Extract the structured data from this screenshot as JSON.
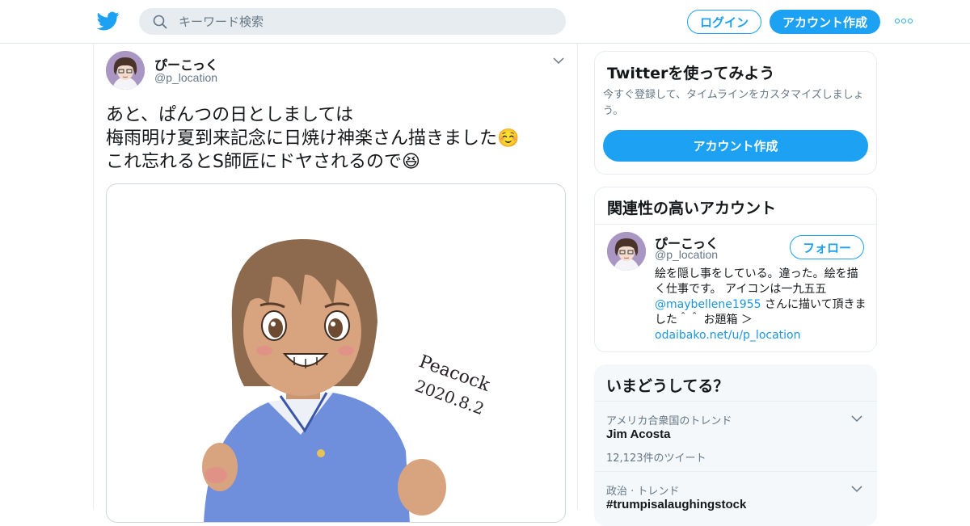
{
  "header": {
    "search_placeholder": "キーワード検索",
    "login_label": "ログイン",
    "signup_label": "アカウント作成",
    "brand_color": "#1da1f2"
  },
  "tweet": {
    "display_name": "ぴーこっく",
    "handle": "@p_location",
    "lines": [
      "あと、ぱんつの日としましては",
      "梅雨明け夏到来記念に日焼け神楽さん描きました☺️",
      "これ忘れるとS師匠にドヤされるので😆"
    ],
    "media": {
      "signature_line1": "Peacock",
      "signature_line2": "2020.8.2"
    }
  },
  "sidebar": {
    "signup_card": {
      "title": "Twitterを使ってみよう",
      "description": "今すぐ登録して、タイムラインをカスタマイズしましょう。",
      "button_label": "アカウント作成"
    },
    "related": {
      "title": "関連性の高いアカウント",
      "account": {
        "display_name": "ぴーこっく",
        "handle": "@p_location",
        "follow_label": "フォロー",
        "bio_part1": "絵を隠し事をしている。違った。絵を描く仕事です。 アイコンは一九五五 ",
        "bio_mention": "@maybellene1955",
        "bio_part2": " さんに描いて頂きました＾＾ お題箱 ＞",
        "bio_link": "odaibako.net/u/p_location"
      }
    },
    "trends": {
      "title": "いまどうしてる？",
      "items": [
        {
          "context": "アメリカ合衆国のトレンド",
          "name": "Jim Acosta",
          "count": "12,123件のツイート"
        },
        {
          "context": "政治 · トレンド",
          "name": "#trumpisalaughingstock",
          "count": ""
        }
      ]
    }
  }
}
